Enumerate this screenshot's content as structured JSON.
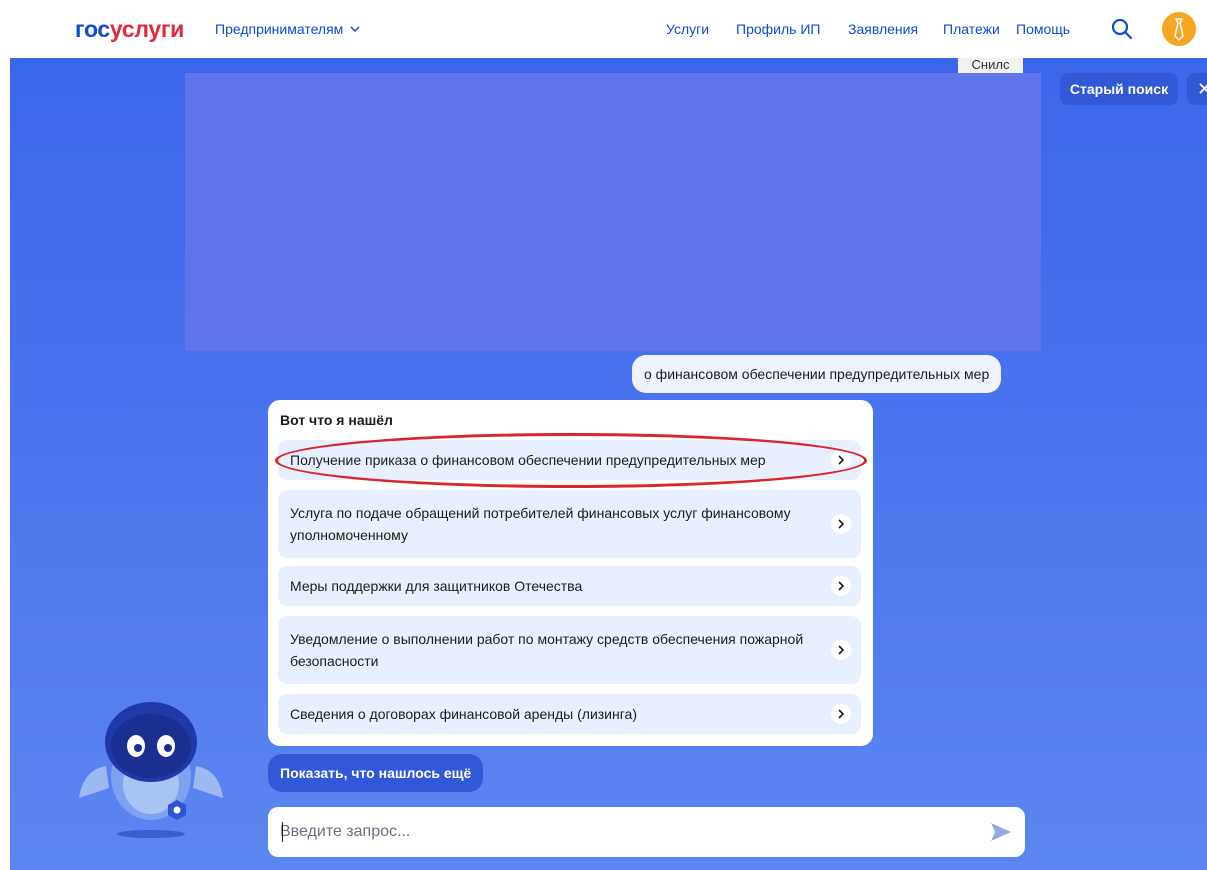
{
  "header": {
    "logo_part1": "гос",
    "logo_part2": "услуги",
    "audience": "Предпринимателям",
    "nav": [
      "Услуги",
      "Профиль ИП",
      "Заявления",
      "Платежи",
      "Помощь"
    ]
  },
  "banner": {
    "snils_tab": "Снилс"
  },
  "top_buttons": {
    "old_search": "Старый поиск",
    "close": "✕"
  },
  "chat": {
    "user_message": "о финансовом обеспечении предупредительных мер",
    "results_title": "Вот что я нашёл",
    "results": [
      "Получение приказа о финансовом обеспечении предупредительных мер",
      "Услуга по подаче обращений потребителей финансовых услуг финансовому уполномоченному",
      "Меры поддержки для защитников Отечества",
      "Уведомление о выполнении работ по монтажу средств обеспечения пожарной безопасности",
      "Сведения о договорах финансовой аренды (лизинга)"
    ],
    "show_more": "Показать, что нашлось ещё",
    "input_placeholder": "Введите запрос..."
  },
  "colors": {
    "brand_blue": "#0d4cd3",
    "brand_red": "#e3283c",
    "highlight": "#d9252b"
  }
}
